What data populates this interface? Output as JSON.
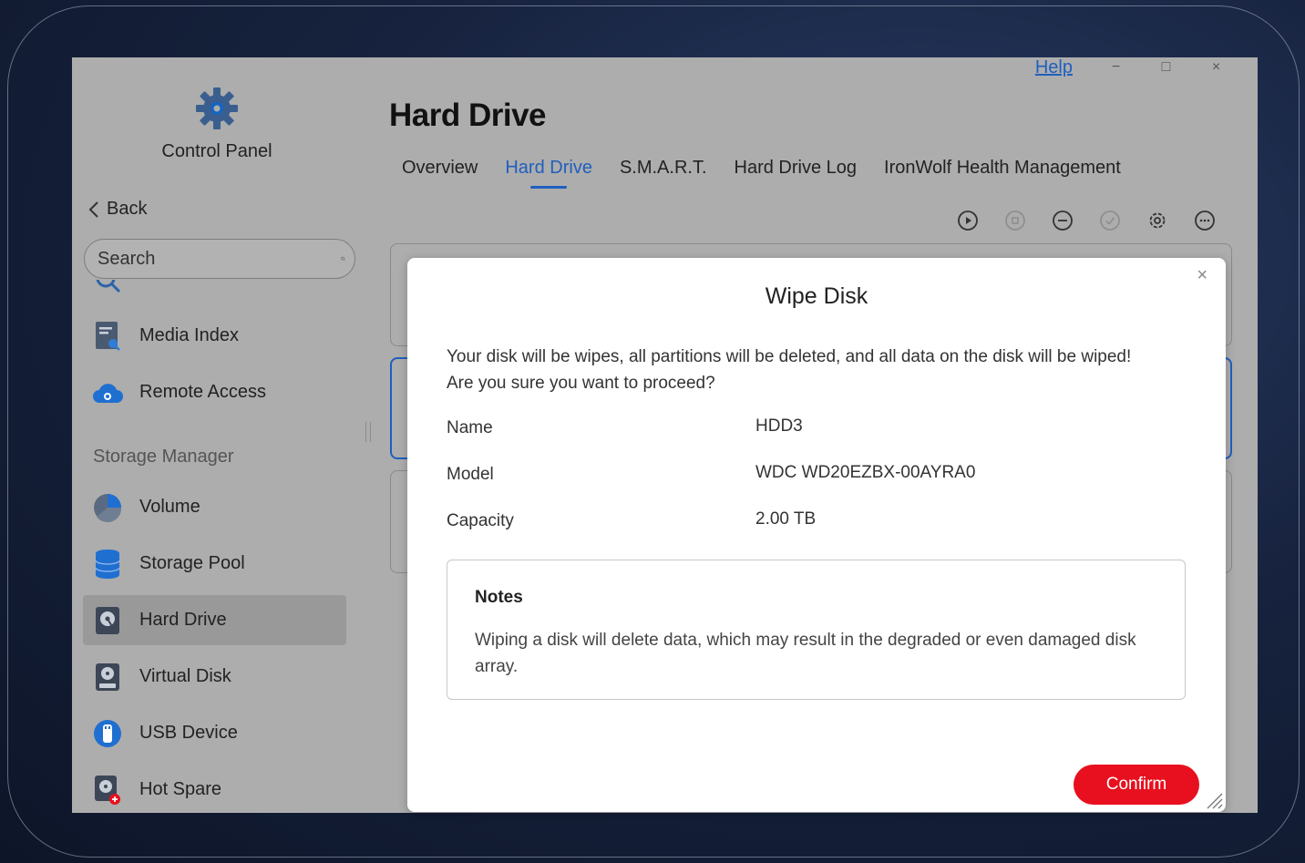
{
  "window": {
    "help_link": "Help",
    "minimize": "−",
    "maximize": "□",
    "close": "×"
  },
  "sidebar": {
    "title": "Control Panel",
    "back_label": "Back",
    "search_placeholder": "Search",
    "items": [
      {
        "label": "Media Index",
        "icon": "media-index-icon"
      },
      {
        "label": "Remote Access",
        "icon": "cloud-icon"
      }
    ],
    "storage_group": "Storage Manager",
    "storage_items": [
      {
        "label": "Volume",
        "icon": "volume-pie-icon"
      },
      {
        "label": "Storage Pool",
        "icon": "storage-pool-icon"
      },
      {
        "label": "Hard Drive",
        "icon": "hard-drive-icon",
        "active": true
      },
      {
        "label": "Virtual Disk",
        "icon": "virtual-disk-icon"
      },
      {
        "label": "USB Device",
        "icon": "usb-icon"
      },
      {
        "label": "Hot Spare",
        "icon": "hot-spare-icon"
      }
    ]
  },
  "main": {
    "title": "Hard Drive",
    "tabs": [
      {
        "label": "Overview"
      },
      {
        "label": "Hard Drive",
        "active": true
      },
      {
        "label": "S.M.A.R.T."
      },
      {
        "label": "Hard Drive Log"
      },
      {
        "label": "IronWolf Health Management"
      }
    ],
    "toolbar_icons": [
      "play-icon",
      "stop-icon",
      "minus-circle-icon",
      "check-circle-icon",
      "gear-icon",
      "more-icon"
    ]
  },
  "dialog": {
    "title": "Wipe Disk",
    "close": "×",
    "message_line1": "Your disk will be wipes, all partitions will be deleted, and all data on the disk will be wiped!",
    "message_line2": "Are you sure you want to proceed?",
    "fields": [
      {
        "label": "Name",
        "value": "HDD3"
      },
      {
        "label": "Model",
        "value": "WDC WD20EZBX-00AYRA0"
      },
      {
        "label": "Capacity",
        "value": "2.00 TB"
      }
    ],
    "notes_title": "Notes",
    "notes_text": "Wiping a disk will delete data, which may result in the degraded or even damaged disk array.",
    "confirm_label": "Confirm"
  },
  "colors": {
    "accent": "#1f5fbf",
    "confirm": "#e8101e",
    "window_bg": "#adadad"
  }
}
